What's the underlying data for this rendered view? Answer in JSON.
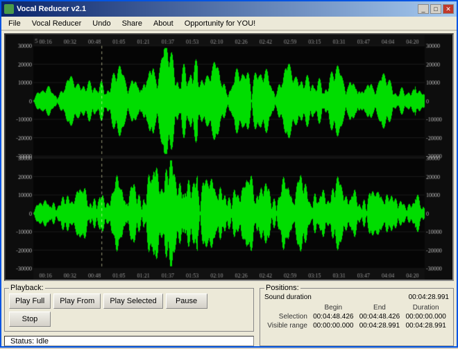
{
  "window": {
    "title": "Vocal Reducer v2.1",
    "icon": "music-icon"
  },
  "menu": {
    "items": [
      "File",
      "Vocal Reducer",
      "Undo",
      "Share",
      "About",
      "Opportunity for YOU!"
    ]
  },
  "waveform": {
    "timeline_labels": [
      "00:16",
      "00:32",
      "00:48",
      "01:05",
      "01:21",
      "01:37",
      "01:53",
      "02:10",
      "02:26",
      "02:42",
      "02:59",
      "03:15",
      "03:31",
      "03:47",
      "04:04",
      "04:20"
    ],
    "y_labels_top": [
      "30000",
      "20000",
      "0",
      "-10000",
      "-20000",
      "-30000"
    ],
    "y_labels_bottom": [
      "30000",
      "20000",
      "0",
      "-10000",
      "-20000",
      "-30000"
    ],
    "y_labels_right_top": [
      "30000",
      "20000",
      "0",
      "-10000",
      "-20000",
      "-30000"
    ],
    "y_labels_right_bottom": [
      "30000",
      "20000",
      "0",
      "-10000",
      "-20000",
      "-30000"
    ]
  },
  "playback": {
    "group_label": "Playback:",
    "buttons": {
      "play_full": "Play Full",
      "play_from": "Play From",
      "play_selected": "Play Selected",
      "pause": "Pause",
      "stop": "Stop"
    },
    "status": "Status: Idle"
  },
  "positions": {
    "group_label": "Positions:",
    "sound_duration_label": "Sound duration",
    "sound_duration_value": "00:04:28.991",
    "columns": [
      "Begin",
      "End",
      "Duration"
    ],
    "rows": [
      {
        "label": "Selection",
        "begin": "00:04:48.426",
        "end": "00:04:48.426",
        "duration": "00:00:00.000"
      },
      {
        "label": "Visible range",
        "begin": "00:00:00.000",
        "end": "00:04:28.991",
        "duration": "00:04:28.991"
      }
    ]
  }
}
